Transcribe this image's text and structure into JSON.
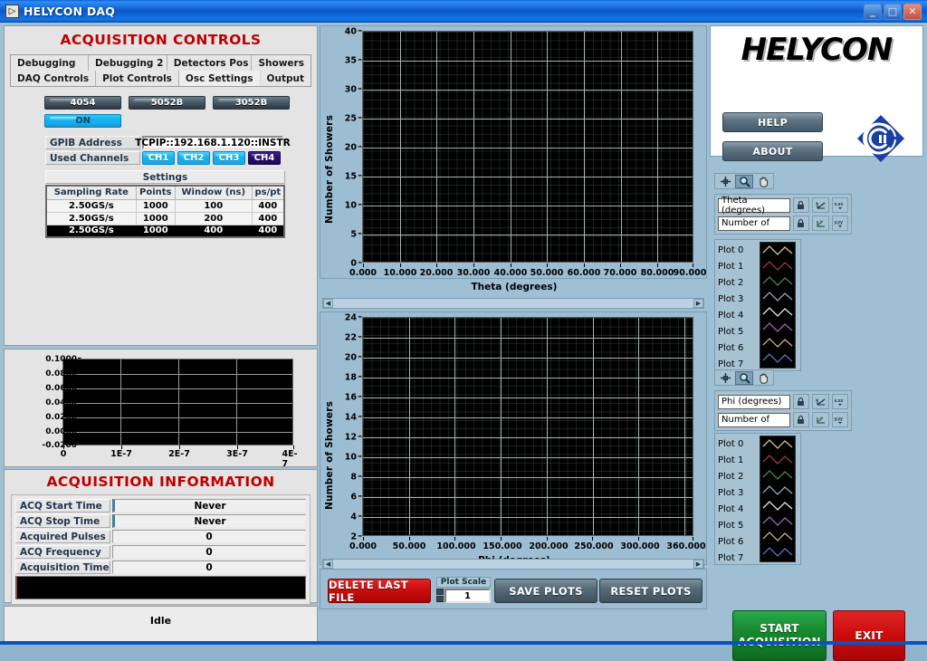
{
  "window": {
    "title": "HELYCON DAQ",
    "icon": "labview-icon",
    "minimize_label": "_",
    "maximize_label": "□",
    "close_label": "✕"
  },
  "acquisition_controls": {
    "title": "ACQUISITION CONTROLS",
    "tabs_row1": [
      {
        "label": "Debugging",
        "active": false
      },
      {
        "label": "Debugging 2",
        "active": false
      },
      {
        "label": "Detectors Pos",
        "active": false
      },
      {
        "label": "Showers",
        "active": false
      }
    ],
    "tabs_row2": [
      {
        "label": "DAQ Controls",
        "active": false
      },
      {
        "label": "Plot Controls",
        "active": false
      },
      {
        "label": "Osc Settings",
        "active": true
      },
      {
        "label": "Output",
        "active": false
      }
    ],
    "devices": [
      {
        "label": "4054"
      },
      {
        "label": "5052B"
      },
      {
        "label": "3052B"
      }
    ],
    "power_label": "ON",
    "gpib_address_label": "GPIB Address",
    "gpib_address_value": "TCPIP::192.168.1.120::INSTR",
    "used_channels_label": "Used Channels",
    "channels": [
      {
        "label": "CH1",
        "enabled": true
      },
      {
        "label": "CH2",
        "enabled": true
      },
      {
        "label": "CH3",
        "enabled": true
      },
      {
        "label": "CH4",
        "enabled": false
      }
    ],
    "settings_title": "Settings",
    "settings_headers": [
      "Sampling Rate",
      "Points",
      "Window (ns)",
      "ps/pt"
    ],
    "settings_rows": [
      {
        "cells": [
          "2.50GS/s",
          "1000",
          "100",
          "400"
        ],
        "selected": false
      },
      {
        "cells": [
          "2.50GS/s",
          "1000",
          "200",
          "400"
        ],
        "selected": false
      },
      {
        "cells": [
          "2.50GS/s",
          "1000",
          "400",
          "400"
        ],
        "selected": true
      }
    ]
  },
  "acquisition_information": {
    "title": "ACQUISITION INFORMATION",
    "rows": [
      {
        "label": "ACQ Start Time",
        "value": "Never"
      },
      {
        "label": "ACQ Stop Time",
        "value": "Never"
      },
      {
        "label": "Acquired Pulses",
        "value": "0"
      },
      {
        "label": "ACQ Frequency",
        "value": "0"
      },
      {
        "label": "Acquisition Time",
        "value": "0"
      }
    ]
  },
  "status": {
    "text": "Idle"
  },
  "branding": {
    "logo_text": "HELYCON",
    "help_label": "HELP",
    "about_label": "ABOUT",
    "secondary_logo": "cc-diamond-logo"
  },
  "plot_toolbar": {
    "cursor_tool": "crosshair-icon",
    "zoom_tool": "magnifier-icon",
    "pan_tool": "hand-icon",
    "lock_icon": "lock-icon",
    "autoscale_icon": "autoscale-icon",
    "format_icon": "number-format-icon"
  },
  "theta_legend": {
    "x_axis_name": "Theta (degrees)",
    "y_axis_name": "Number of",
    "plots": [
      {
        "label": "Plot 0",
        "color": "#d8c878"
      },
      {
        "label": "Plot 1",
        "color": "#9e3a36"
      },
      {
        "label": "Plot 2",
        "color": "#3f8c48"
      },
      {
        "label": "Plot 3",
        "color": "#93a8c4"
      },
      {
        "label": "Plot 4",
        "color": "#e8e8e0"
      },
      {
        "label": "Plot 5",
        "color": "#a462b8"
      },
      {
        "label": "Plot 6",
        "color": "#d8b068"
      },
      {
        "label": "Plot 7",
        "color": "#6a6ac8"
      }
    ]
  },
  "phi_legend": {
    "x_axis_name": "Phi (degrees)",
    "y_axis_name": "Number of",
    "plots": [
      {
        "label": "Plot 0",
        "color": "#d8c878"
      },
      {
        "label": "Plot 1",
        "color": "#9e3a36"
      },
      {
        "label": "Plot 2",
        "color": "#3f8c48"
      },
      {
        "label": "Plot 3",
        "color": "#93a8c4"
      },
      {
        "label": "Plot 4",
        "color": "#e8e8e0"
      },
      {
        "label": "Plot 5",
        "color": "#a462b8"
      },
      {
        "label": "Plot 6",
        "color": "#d8b068"
      },
      {
        "label": "Plot 7",
        "color": "#6a6ac8"
      }
    ]
  },
  "plot_controls": {
    "delete_last_file": "DELETE LAST FILE",
    "plot_scale_label": "Plot Scale",
    "plot_scale_value": "1",
    "save_plots": "SAVE PLOTS",
    "reset_plots": "RESET PLOTS"
  },
  "actions": {
    "start_line1": "START",
    "start_line2": "ACQUISITION",
    "exit_label": "EXIT"
  },
  "chart_data": [
    {
      "id": "theta_histogram",
      "type": "bar",
      "title": "",
      "xlabel": "Theta (degrees)",
      "ylabel": "Number of Showers",
      "xlim": [
        0,
        90
      ],
      "ylim": [
        0,
        40
      ],
      "xticks": [
        "0.000",
        "10.000",
        "20.000",
        "30.000",
        "40.000",
        "50.000",
        "60.000",
        "70.000",
        "80.000",
        "90.000"
      ],
      "yticks": [
        0,
        5,
        10,
        15,
        20,
        25,
        30,
        35,
        40
      ],
      "grid": true,
      "legend_position": "right",
      "series": [],
      "values": [],
      "categories": []
    },
    {
      "id": "phi_histogram",
      "type": "bar",
      "title": "",
      "xlabel": "Phi (degrees)",
      "ylabel": "Number of Showers",
      "xlim": [
        0,
        360
      ],
      "ylim": [
        2,
        24
      ],
      "xticks": [
        "0.000",
        "50.000",
        "100.000",
        "150.000",
        "200.000",
        "250.000",
        "300.000",
        "360.000"
      ],
      "yticks": [
        2,
        4,
        6,
        8,
        10,
        12,
        14,
        16,
        18,
        20,
        22,
        24
      ],
      "grid": true,
      "legend_position": "right",
      "series": [],
      "values": [],
      "categories": []
    },
    {
      "id": "waveform_plot",
      "type": "line",
      "title": "",
      "xlabel": "",
      "ylabel": "",
      "xlim": [
        0,
        4e-07
      ],
      "ylim": [
        -0.02,
        0.1
      ],
      "xticks": [
        "0",
        "1E-7",
        "2E-7",
        "3E-7",
        "4E-7"
      ],
      "yticks": [
        "0.1000",
        "0.0800",
        "0.0600",
        "0.0400",
        "0.0200",
        "0.0000",
        "-0.0200"
      ],
      "grid": true,
      "legend_position": "none",
      "series": [],
      "values": [],
      "categories": []
    }
  ]
}
